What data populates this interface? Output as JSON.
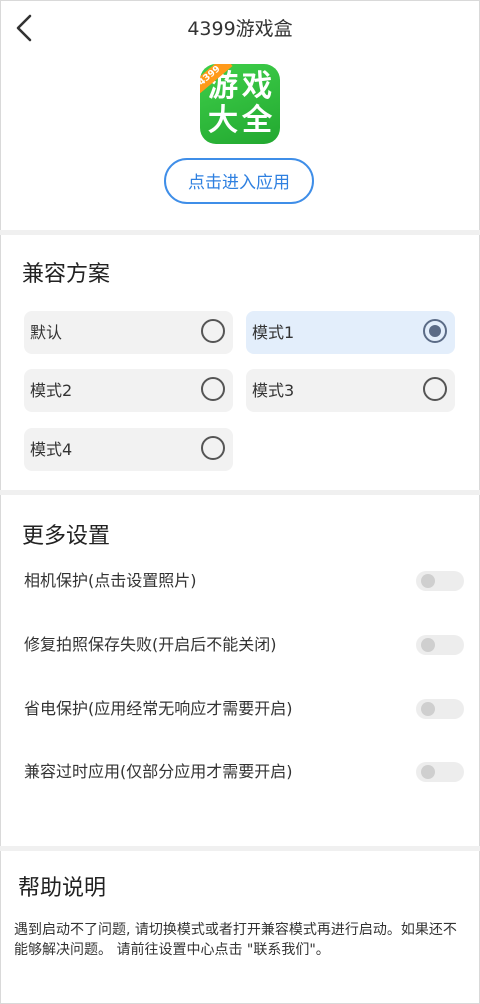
{
  "header": {
    "title": "4399游戏盒",
    "back_icon": "back-arrow-icon"
  },
  "app": {
    "icon_text": [
      "游",
      "戏",
      "大",
      "全"
    ],
    "icon_tag": "4399",
    "enter_label": "点击进入应用",
    "accent_color": "#2f80e0",
    "icon_color": "#2fbf3a"
  },
  "compat": {
    "title": "兼容方案",
    "modes": [
      {
        "label": "默认",
        "selected": false
      },
      {
        "label": "模式1",
        "selected": true
      },
      {
        "label": "模式2",
        "selected": false
      },
      {
        "label": "模式3",
        "selected": false
      },
      {
        "label": "模式4",
        "selected": false
      }
    ]
  },
  "more": {
    "title": "更多设置",
    "settings": [
      {
        "label": "相机保护(点击设置照片)",
        "enabled": false
      },
      {
        "label": "修复拍照保存失败(开启后不能关闭)",
        "enabled": false
      },
      {
        "label": "省电保护(应用经常无响应才需要开启)",
        "enabled": false
      },
      {
        "label": "兼容过时应用(仅部分应用才需要开启)",
        "enabled": false
      }
    ]
  },
  "help": {
    "title": "帮助说明",
    "text": "遇到启动不了问题, 请切换模式或者打开兼容模式再进行启动。如果还不能够解决问题。 请前往设置中心点击 \"联系我们\"。"
  }
}
